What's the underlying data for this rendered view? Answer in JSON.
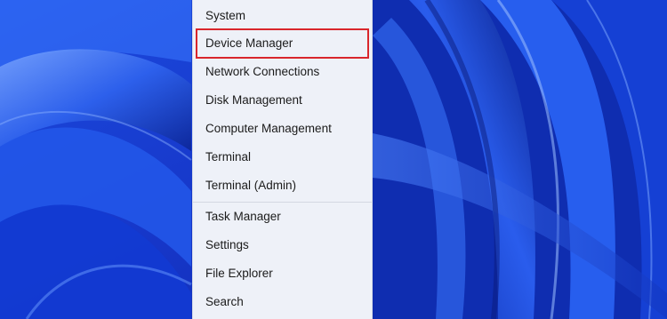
{
  "wallpaper": {
    "name": "windows-11-bloom-wallpaper",
    "base_color": "#1a3fd0",
    "light_color": "#5a8cff",
    "dark_color": "#0a1e8a"
  },
  "context_menu": {
    "highlight_color": "#d9262c",
    "items": [
      {
        "label": "System"
      },
      {
        "label": "Device Manager",
        "highlighted": true
      },
      {
        "label": "Network Connections"
      },
      {
        "label": "Disk Management"
      },
      {
        "label": "Computer Management"
      },
      {
        "label": "Terminal"
      },
      {
        "label": "Terminal (Admin)"
      },
      {
        "label": "Task Manager"
      },
      {
        "label": "Settings"
      },
      {
        "label": "File Explorer"
      },
      {
        "label": "Search"
      }
    ]
  }
}
